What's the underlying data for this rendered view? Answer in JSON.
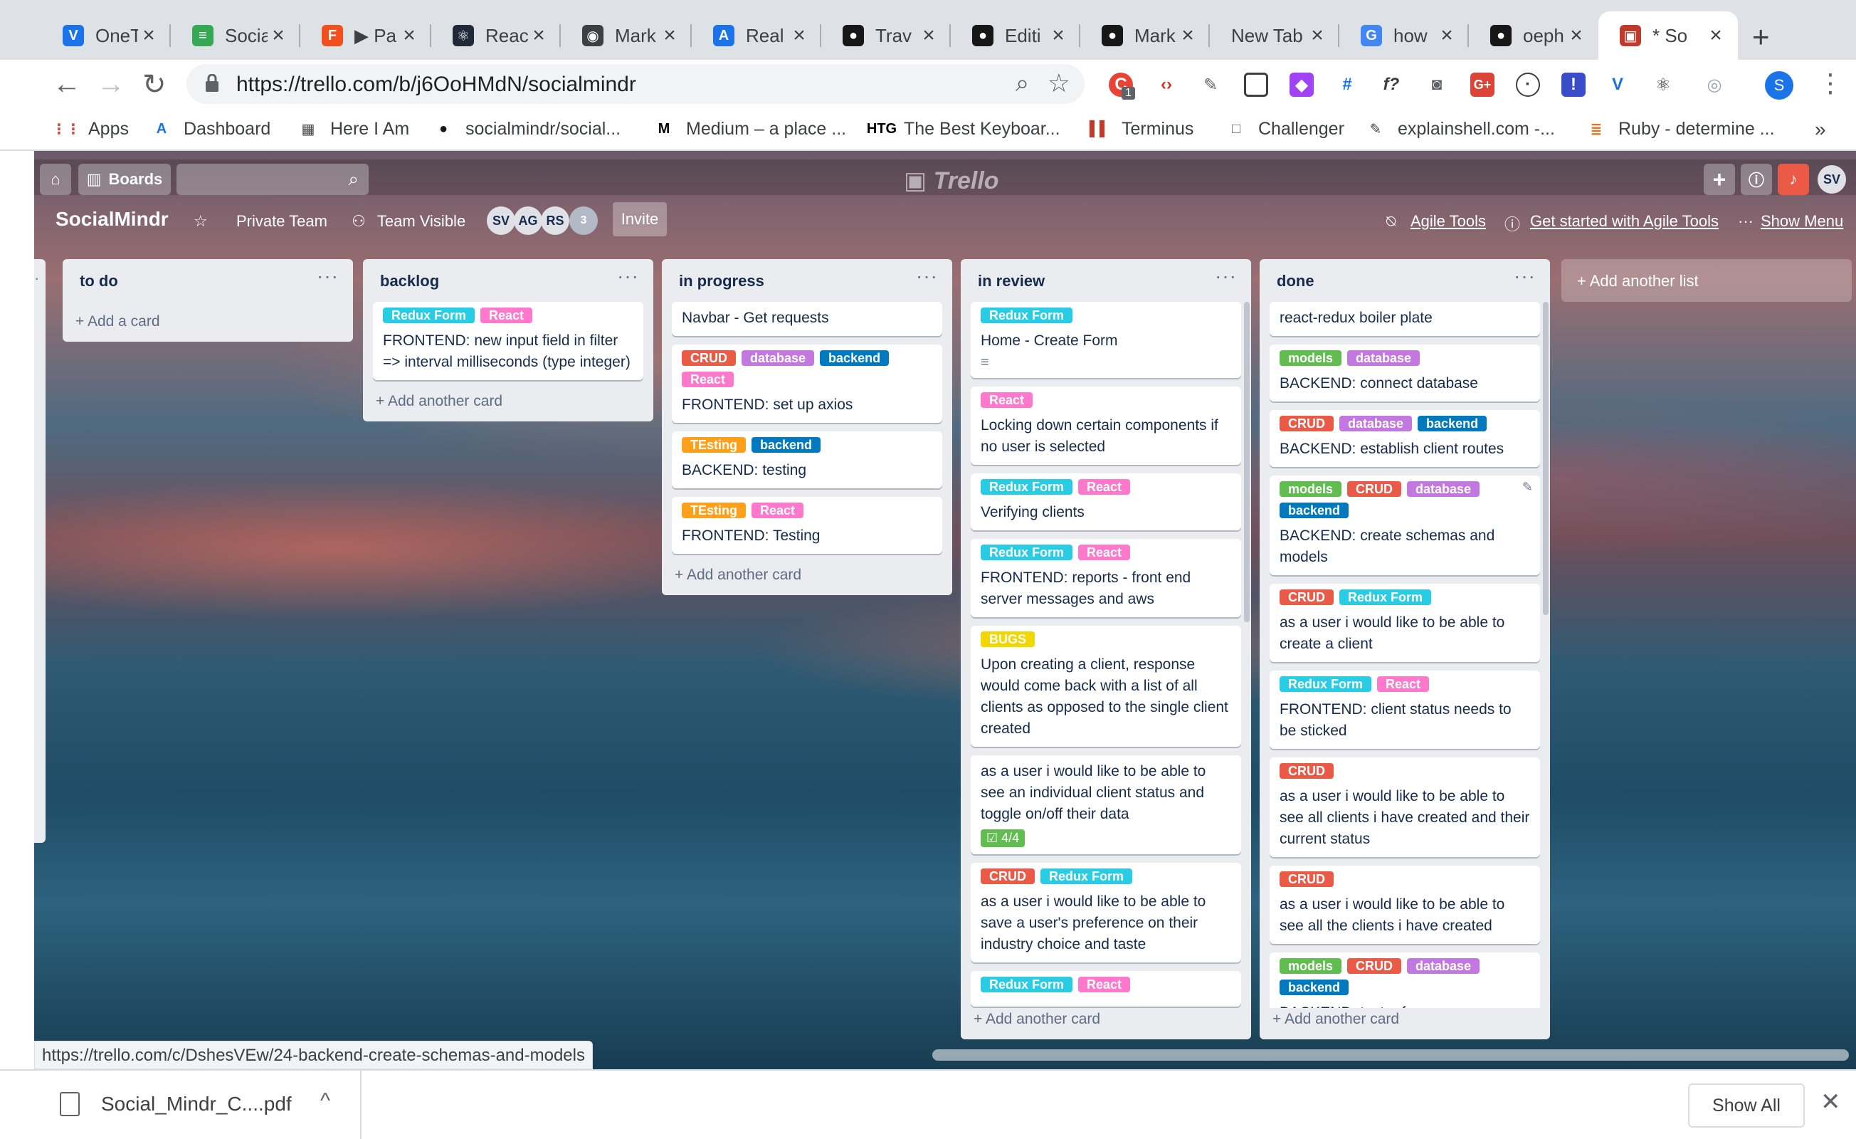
{
  "browser": {
    "tabs": [
      {
        "label": "OneT",
        "icon": "V",
        "color": "#1a73e8"
      },
      {
        "label": "Socia",
        "icon": "≡",
        "color": "#34a853"
      },
      {
        "label": "▶ Pa",
        "icon": "F",
        "color": "#f24e1e"
      },
      {
        "label": "Reac",
        "icon": "⚛",
        "color": "#1f2937"
      },
      {
        "label": "Mark",
        "icon": "◉",
        "color": "#3c4043"
      },
      {
        "label": "Real",
        "icon": "A",
        "color": "#1a73e8"
      },
      {
        "label": "Trav",
        "icon": "●",
        "color": "#181717"
      },
      {
        "label": "Editi",
        "icon": "●",
        "color": "#181717"
      },
      {
        "label": "Mark",
        "icon": "●",
        "color": "#181717"
      },
      {
        "label": "New Tab",
        "icon": "",
        "color": "#dee1e6"
      },
      {
        "label": "how",
        "icon": "G",
        "color": "#4285f4"
      },
      {
        "label": "oeph",
        "icon": "●",
        "color": "#181717"
      },
      {
        "label": "* So",
        "icon": "▣",
        "color": "#c0392b"
      }
    ],
    "url": "https://trello.com/b/j6OoHMdN/socialmindr",
    "bookmarks": [
      {
        "label": "Apps",
        "icon": "⋮⋮"
      },
      {
        "label": "Dashboard",
        "icon": "A"
      },
      {
        "label": "Here I Am",
        "icon": "▦"
      },
      {
        "label": "socialmindr/social...",
        "icon": "●"
      },
      {
        "label": "Medium – a place ...",
        "icon": "M"
      },
      {
        "label": "The Best Keyboar...",
        "icon": "HTG"
      },
      {
        "label": "Terminus",
        "icon": "▌▌"
      },
      {
        "label": "Challenger",
        "icon": "□"
      },
      {
        "label": "explainshell.com -...",
        "icon": "✎"
      },
      {
        "label": "Ruby - determine ...",
        "icon": "≣"
      }
    ],
    "bookmarks_more": "»",
    "profile_initial": "S",
    "extension_badge": "1"
  },
  "trello": {
    "boards_label": "Boards",
    "logo": "Trello",
    "user_initials": "SV",
    "board_name": "SocialMindr",
    "private_team": "Private Team",
    "team_visible": "Team Visible",
    "members": [
      "SV",
      "AG",
      "RS"
    ],
    "member_extra": "3",
    "invite": "Invite",
    "agile_tools": "Agile Tools",
    "get_started": "Get started with Agile Tools",
    "show_menu": "Show Menu",
    "add_list": "+ Add another list",
    "label_colors": {
      "Redux Form": "#29cce5",
      "React": "#ff78cb",
      "CRUD": "#eb5a46",
      "database": "#c377e0",
      "backend": "#0079bf",
      "TEsting": "#ff9f1a",
      "BUGS": "#f2d600",
      "models": "#61bd4f"
    },
    "lists": [
      {
        "title": "to do",
        "add_label": "+ Add a card",
        "cards": []
      },
      {
        "title": "backlog",
        "add_label": "+ Add another card",
        "cards": [
          {
            "labels": [
              "Redux Form",
              "React"
            ],
            "title": "FRONTEND: new input field in filter => interval milliseconds (type integer)"
          }
        ]
      },
      {
        "title": "in progress",
        "add_label": "+ Add another card",
        "cards": [
          {
            "labels": [],
            "title": "Navbar - Get requests"
          },
          {
            "labels": [
              "CRUD",
              "database",
              "backend",
              "React"
            ],
            "title": "FRONTEND: set up axios"
          },
          {
            "labels": [
              "TEsting",
              "backend"
            ],
            "title": "BACKEND: testing"
          },
          {
            "labels": [
              "TEsting",
              "React"
            ],
            "title": "FRONTEND: Testing"
          }
        ]
      },
      {
        "title": "in review",
        "add_label": "+ Add another card",
        "cards": [
          {
            "labels": [
              "Redux Form"
            ],
            "title": "Home - Create Form",
            "desc_icon": "≡"
          },
          {
            "labels": [
              "React"
            ],
            "title": "Locking down certain components if no user is selected"
          },
          {
            "labels": [
              "Redux Form",
              "React"
            ],
            "title": "Verifying clients"
          },
          {
            "labels": [
              "Redux Form",
              "React"
            ],
            "title": "FRONTEND: reports - front end server messages and aws"
          },
          {
            "labels": [
              "BUGS"
            ],
            "title": "Upon creating a client, response would come back with a list of all clients as opposed to the single client created"
          },
          {
            "labels": [],
            "title": "as a user i would like to be able to see an individual client status and toggle on/off their data",
            "checklist": "☑ 4/4"
          },
          {
            "labels": [
              "CRUD",
              "Redux Form"
            ],
            "title": "as a user i would like to be able to save a user's preference on their industry choice and taste"
          },
          {
            "labels": [
              "Redux Form",
              "React"
            ],
            "title": ""
          }
        ]
      },
      {
        "title": "done",
        "add_label": "+ Add another card",
        "cards": [
          {
            "labels": [],
            "title": "react-redux boiler plate"
          },
          {
            "labels": [
              "models",
              "database"
            ],
            "title": "BACKEND: connect database"
          },
          {
            "labels": [
              "CRUD",
              "database",
              "backend"
            ],
            "title": "BACKEND: establish client routes"
          },
          {
            "labels": [
              "models",
              "CRUD",
              "database",
              "backend"
            ],
            "title": "BACKEND: create schemas and models",
            "editing": true
          },
          {
            "labels": [
              "CRUD",
              "Redux Form"
            ],
            "title": "as a user i would like to be able to create a client"
          },
          {
            "labels": [
              "Redux Form",
              "React"
            ],
            "title": "FRONTEND: client status needs to be sticked"
          },
          {
            "labels": [
              "CRUD"
            ],
            "title": "as a user i would like to be able to see all clients i have created and their current status"
          },
          {
            "labels": [
              "CRUD"
            ],
            "title": "as a user i would like to be able to see all the clients i have created"
          },
          {
            "labels": [
              "models",
              "CRUD",
              "database",
              "backend"
            ],
            "title": "BACKEND: test reference"
          }
        ]
      }
    ]
  },
  "status_bar_url": "https://trello.com/c/DshesVEw/24-backend-create-schemas-and-models",
  "downloads": {
    "file": "Social_Mindr_C....pdf",
    "show_all": "Show All"
  }
}
